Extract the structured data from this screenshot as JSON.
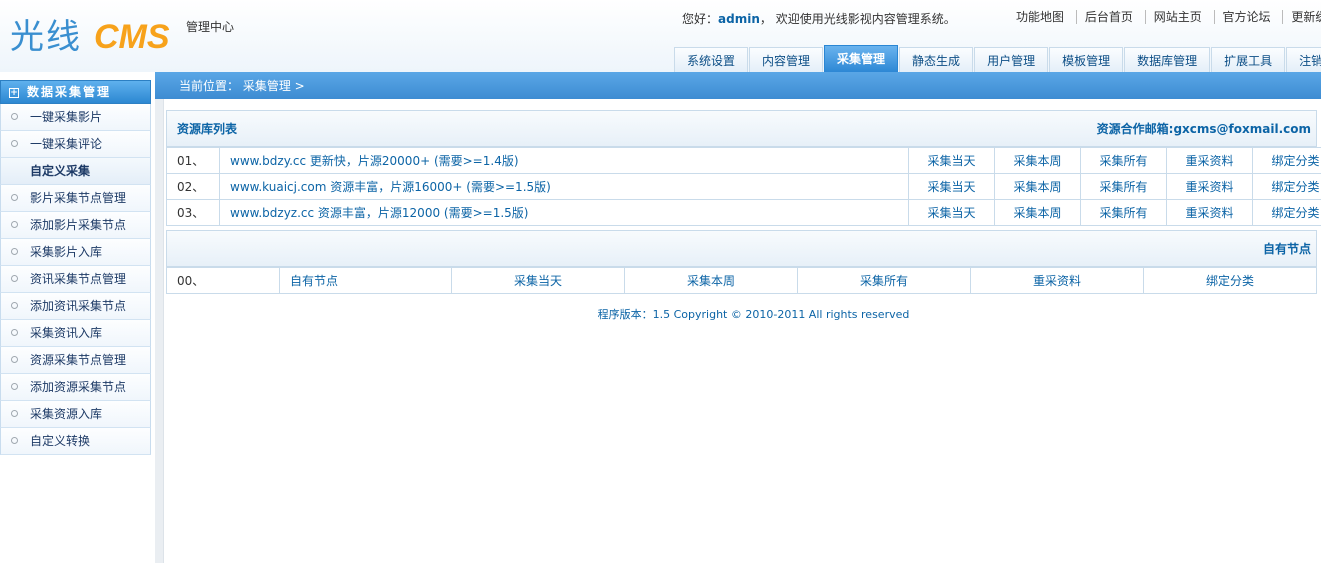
{
  "header": {
    "logo_cn": "光线",
    "logo_en": "CMS",
    "logo_sub": "管理中心",
    "welcome_prefix": "您好：",
    "user": "admin",
    "welcome_suffix": "，  欢迎使用光线影视内容管理系统。",
    "top_links": [
      "功能地图",
      "后台首页",
      "网站主页",
      "官方论坛",
      "更新缓存"
    ]
  },
  "tabs": [
    {
      "label": "系统设置",
      "active": false
    },
    {
      "label": "内容管理",
      "active": false
    },
    {
      "label": "采集管理",
      "active": true
    },
    {
      "label": "静态生成",
      "active": false
    },
    {
      "label": "用户管理",
      "active": false
    },
    {
      "label": "模板管理",
      "active": false
    },
    {
      "label": "数据库管理",
      "active": false
    },
    {
      "label": "扩展工具",
      "active": false
    },
    {
      "label": "注销登录",
      "active": false
    }
  ],
  "breadcrumb": {
    "prefix": "当前位置：",
    "path": "采集管理 >"
  },
  "sidebar": {
    "header": "数据采集管理",
    "header_icon": "⊞",
    "items": [
      {
        "label": "一键采集影片",
        "type": "link"
      },
      {
        "label": "一键采集评论",
        "type": "link"
      },
      {
        "label": "自定义采集",
        "type": "label"
      },
      {
        "label": "影片采集节点管理",
        "type": "link"
      },
      {
        "label": "添加影片采集节点",
        "type": "link"
      },
      {
        "label": "采集影片入库",
        "type": "link"
      },
      {
        "label": "资讯采集节点管理",
        "type": "link"
      },
      {
        "label": "添加资讯采集节点",
        "type": "link"
      },
      {
        "label": "采集资讯入库",
        "type": "link"
      },
      {
        "label": "资源采集节点管理",
        "type": "link"
      },
      {
        "label": "添加资源采集节点",
        "type": "link"
      },
      {
        "label": "采集资源入库",
        "type": "link"
      },
      {
        "label": "自定义转换",
        "type": "link"
      }
    ]
  },
  "resource_list": {
    "title": "资源库列表",
    "contact": "资源合作邮箱:gxcms@foxmail.com",
    "rows": [
      {
        "num": "01、",
        "desc": "www.bdzy.cc 更新快，片源20000+ (需要>=1.4版)"
      },
      {
        "num": "02、",
        "desc": "www.kuaicj.com 资源丰富，片源16000+ (需要>=1.5版)"
      },
      {
        "num": "03、",
        "desc": "www.bdzyz.cc 资源丰富，片源12000 (需要>=1.5版)"
      }
    ],
    "actions": [
      "采集当天",
      "采集本周",
      "采集所有",
      "重采资料",
      "绑定分类"
    ]
  },
  "own_nodes": {
    "title": "自有节点",
    "row": {
      "num": "00、",
      "name": "自有节点",
      "actions": [
        "采集当天",
        "采集本周",
        "采集所有",
        "重采资料",
        "绑定分类"
      ]
    }
  },
  "footer": "程序版本：1.5    Copyright © 2010-2011 All rights reserved"
}
